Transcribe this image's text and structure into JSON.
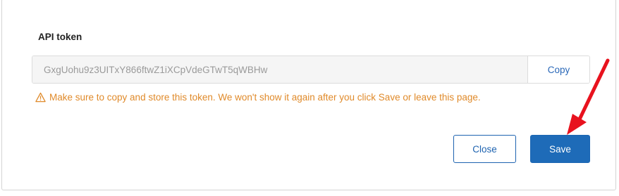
{
  "token": {
    "label": "API token",
    "value": "GxgUohu9z3UITxY866ftwZ1iXCpVdeGTwT5qWBHw",
    "copy_label": "Copy"
  },
  "warning": {
    "icon": "warning-triangle-icon",
    "text": "Make sure to copy and store this token. We won't show it again after you click Save or leave this page."
  },
  "actions": {
    "close_label": "Close",
    "save_label": "Save"
  },
  "annotation": {
    "icon": "red-arrow-icon",
    "color": "#e8121e"
  },
  "colors": {
    "accent": "#1e6bb8",
    "warning": "#e08a2a"
  }
}
